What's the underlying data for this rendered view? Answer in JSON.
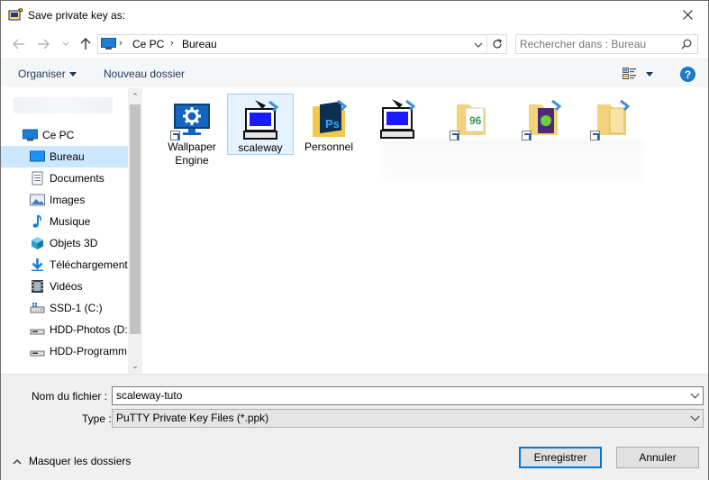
{
  "window": {
    "title": "Save private key as:"
  },
  "address": {
    "root": "Ce PC",
    "current": "Bureau"
  },
  "search": {
    "placeholder": "Rechercher dans : Bureau"
  },
  "toolbar": {
    "organize_label": "Organiser",
    "new_folder_label": "Nouveau dossier",
    "help_label": "?"
  },
  "sidebar": {
    "items": [
      {
        "label": "Ce PC",
        "icon": "pc-icon"
      },
      {
        "label": "Bureau",
        "icon": "desktop-icon",
        "selected": true
      },
      {
        "label": "Documents",
        "icon": "documents-icon"
      },
      {
        "label": "Images",
        "icon": "images-icon"
      },
      {
        "label": "Musique",
        "icon": "music-icon"
      },
      {
        "label": "Objets 3D",
        "icon": "cube-3d-icon"
      },
      {
        "label": "Téléchargements",
        "icon": "download-icon"
      },
      {
        "label": "Vidéos",
        "icon": "video-icon"
      },
      {
        "label": "SSD-1 (C:)",
        "icon": "drive-icon"
      },
      {
        "label": "HDD-Photos (D:",
        "icon": "drive-icon"
      },
      {
        "label": "HDD-Programm",
        "icon": "drive-icon"
      }
    ]
  },
  "files": [
    {
      "label": "Wallpaper Engine",
      "icon": "wallpaper-engine-icon"
    },
    {
      "label": "scaleway",
      "icon": "putty-icon",
      "selected": true
    },
    {
      "label": "Personnel",
      "icon": "photoshop-folder-icon"
    },
    {
      "label": "",
      "icon": "putty-icon"
    },
    {
      "label": "",
      "icon": "folder-icon"
    },
    {
      "label": "",
      "icon": "folder-icon"
    },
    {
      "label": "",
      "icon": "folder-icon"
    }
  ],
  "form": {
    "filename_label": "Nom du fichier :",
    "filename_value": "scaleway-tuto",
    "type_label": "Type :",
    "type_value": "PuTTY Private Key Files (*.ppk)"
  },
  "footer": {
    "hide_folders_label": "Masquer les dossiers",
    "save_label": "Enregistrer",
    "cancel_label": "Annuler"
  },
  "colors": {
    "accent": "#0078d7",
    "selection": "#cce8ff",
    "help": "#1979ca"
  }
}
